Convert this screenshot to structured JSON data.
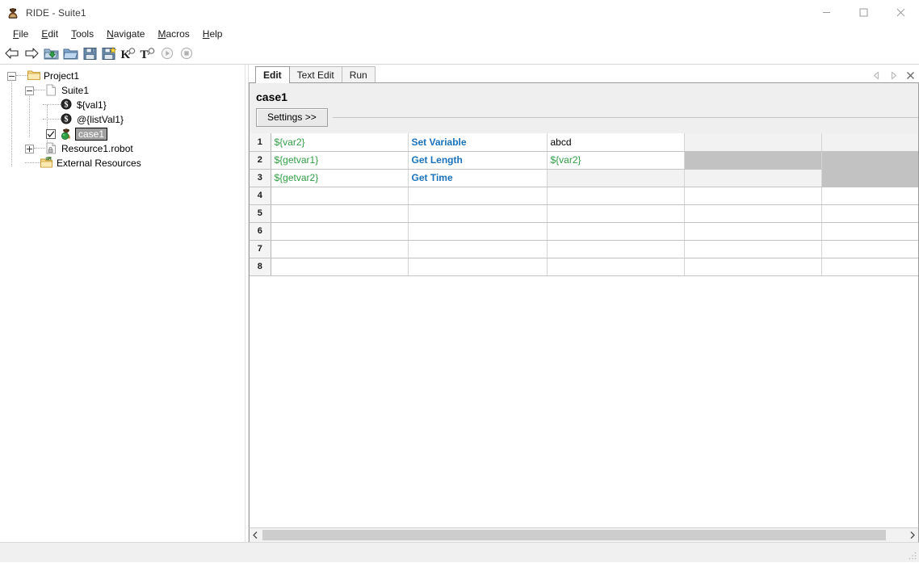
{
  "window": {
    "title": "RIDE - Suite1",
    "app_icon": "ride-icon",
    "buttons": {
      "minimize": "minimize-icon",
      "maximize": "maximize-icon",
      "close": "close-icon"
    }
  },
  "menubar": {
    "items": [
      {
        "label": "File",
        "mnemonic": "F"
      },
      {
        "label": "Edit",
        "mnemonic": "E"
      },
      {
        "label": "Tools",
        "mnemonic": "T"
      },
      {
        "label": "Navigate",
        "mnemonic": "N"
      },
      {
        "label": "Macros",
        "mnemonic": "M"
      },
      {
        "label": "Help",
        "mnemonic": "H"
      }
    ]
  },
  "toolbar": {
    "buttons": [
      {
        "name": "back-arrow-icon",
        "title": "Go Back"
      },
      {
        "name": "forward-arrow-icon",
        "title": "Go Forward"
      },
      {
        "name": "open-project-icon",
        "title": "Open Directory"
      },
      {
        "name": "open-folder-icon",
        "title": "Open"
      },
      {
        "name": "save-icon",
        "title": "Save"
      },
      {
        "name": "save-all-icon",
        "title": "Save All"
      },
      {
        "name": "search-keyword-icon",
        "title": "Search Keywords"
      },
      {
        "name": "search-tests-icon",
        "title": "Search Tests"
      },
      {
        "name": "run-icon",
        "title": "Run",
        "disabled": true
      },
      {
        "name": "stop-icon",
        "title": "Stop",
        "disabled": true
      }
    ]
  },
  "tree": {
    "nodes": [
      {
        "label": "Project1",
        "icon": "folder-icon",
        "depth": 0,
        "expander": "minus",
        "selected": false,
        "checkbox": false
      },
      {
        "label": "Suite1",
        "icon": "file-icon",
        "depth": 1,
        "expander": "minus",
        "selected": false,
        "checkbox": false
      },
      {
        "label": "${val1}",
        "icon": "variable-icon",
        "depth": 2,
        "expander": "none",
        "selected": false,
        "checkbox": false
      },
      {
        "label": "@{listVal1}",
        "icon": "variable-icon",
        "depth": 2,
        "expander": "none",
        "selected": false,
        "checkbox": false
      },
      {
        "label": "case1",
        "icon": "testcase-icon",
        "depth": 2,
        "expander": "none",
        "selected": true,
        "checkbox": true,
        "checked": true
      },
      {
        "label": "Resource1.robot",
        "icon": "resource-file-icon",
        "depth": 1,
        "expander": "plus",
        "selected": false,
        "checkbox": false
      },
      {
        "label": "External Resources",
        "icon": "external-folder-icon",
        "depth": 1,
        "expander": "none",
        "selected": false,
        "checkbox": false
      }
    ]
  },
  "editor": {
    "tabs": [
      {
        "label": "Edit",
        "active": true
      },
      {
        "label": "Text Edit",
        "active": false
      },
      {
        "label": "Run",
        "active": false
      }
    ],
    "tab_nav": {
      "prev": "chevron-left-icon",
      "next": "chevron-right-icon",
      "close": "close-icon"
    },
    "case_title": "case1",
    "settings_button": "Settings >>",
    "grid": {
      "row_count": 8,
      "column_count": 5,
      "rows": [
        {
          "number": "1",
          "cells": [
            {
              "text": "${var2}",
              "style": "var",
              "shade": "none"
            },
            {
              "text": "Set Variable",
              "style": "kw",
              "shade": "none"
            },
            {
              "text": "abcd",
              "style": "plain",
              "shade": "none"
            },
            {
              "text": "",
              "style": "plain",
              "shade": "light"
            },
            {
              "text": "",
              "style": "plain",
              "shade": "light"
            }
          ]
        },
        {
          "number": "2",
          "cells": [
            {
              "text": "${getvar1}",
              "style": "var",
              "shade": "none"
            },
            {
              "text": "Get Length",
              "style": "kw",
              "shade": "none"
            },
            {
              "text": "${var2}",
              "style": "var",
              "shade": "none"
            },
            {
              "text": "",
              "style": "plain",
              "shade": "dark"
            },
            {
              "text": "",
              "style": "plain",
              "shade": "dark"
            }
          ]
        },
        {
          "number": "3",
          "cells": [
            {
              "text": "${getvar2}",
              "style": "var",
              "shade": "none"
            },
            {
              "text": "Get Time",
              "style": "kw",
              "shade": "none"
            },
            {
              "text": "",
              "style": "plain",
              "shade": "light"
            },
            {
              "text": "",
              "style": "plain",
              "shade": "light"
            },
            {
              "text": "",
              "style": "plain",
              "shade": "dark"
            }
          ]
        },
        {
          "number": "4",
          "cells": [
            {
              "text": "",
              "style": "plain",
              "shade": "none"
            },
            {
              "text": "",
              "style": "plain",
              "shade": "none"
            },
            {
              "text": "",
              "style": "plain",
              "shade": "none"
            },
            {
              "text": "",
              "style": "plain",
              "shade": "none"
            },
            {
              "text": "",
              "style": "plain",
              "shade": "none"
            }
          ]
        },
        {
          "number": "5",
          "cells": [
            {
              "text": "",
              "style": "plain",
              "shade": "none"
            },
            {
              "text": "",
              "style": "plain",
              "shade": "none"
            },
            {
              "text": "",
              "style": "plain",
              "shade": "none"
            },
            {
              "text": "",
              "style": "plain",
              "shade": "none"
            },
            {
              "text": "",
              "style": "plain",
              "shade": "none"
            }
          ]
        },
        {
          "number": "6",
          "cells": [
            {
              "text": "",
              "style": "plain",
              "shade": "none"
            },
            {
              "text": "",
              "style": "plain",
              "shade": "none"
            },
            {
              "text": "",
              "style": "plain",
              "shade": "none"
            },
            {
              "text": "",
              "style": "plain",
              "shade": "none"
            },
            {
              "text": "",
              "style": "plain",
              "shade": "none"
            }
          ]
        },
        {
          "number": "7",
          "cells": [
            {
              "text": "",
              "style": "plain",
              "shade": "none"
            },
            {
              "text": "",
              "style": "plain",
              "shade": "none"
            },
            {
              "text": "",
              "style": "plain",
              "shade": "none"
            },
            {
              "text": "",
              "style": "plain",
              "shade": "none"
            },
            {
              "text": "",
              "style": "plain",
              "shade": "none"
            }
          ]
        },
        {
          "number": "8",
          "cells": [
            {
              "text": "",
              "style": "plain",
              "shade": "none"
            },
            {
              "text": "",
              "style": "plain",
              "shade": "none"
            },
            {
              "text": "",
              "style": "plain",
              "shade": "none"
            },
            {
              "text": "",
              "style": "plain",
              "shade": "none"
            },
            {
              "text": "",
              "style": "plain",
              "shade": "none"
            }
          ]
        }
      ]
    },
    "hscrollbar": {
      "left_arrow": "chevron-left-icon",
      "right_arrow": "chevron-right-icon",
      "thumb_percent": 97
    }
  },
  "colors": {
    "variable_green": "#2f9e44",
    "keyword_blue": "#1a72bd",
    "selection_gray": "#a0a0a0",
    "cell_shade_dark": "#c2c2c2",
    "cell_shade_light": "#f2f2f2",
    "panel_gray": "#efefef",
    "status_gray": "#f0f0f0"
  }
}
